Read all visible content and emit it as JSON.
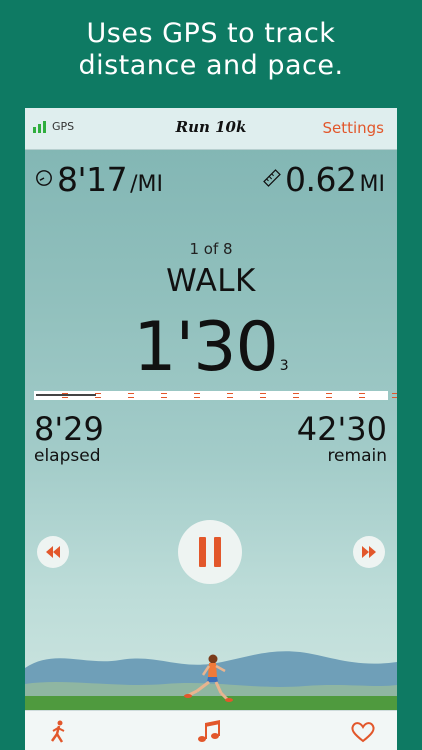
{
  "headline": {
    "line1": "Uses GPS to track",
    "line2": "distance and pace."
  },
  "navbar": {
    "gps_label": "GPS",
    "title": "Run 10k",
    "settings_label": "Settings"
  },
  "stats": {
    "pace_value": "8'17",
    "pace_unit": "/MI",
    "distance_value": "0.62",
    "distance_unit": "MI"
  },
  "interval": {
    "counter": "1 of 8",
    "phase": "WALK",
    "time_main": "1'30",
    "time_sub": "3",
    "progress_fraction": 0.17
  },
  "summary": {
    "elapsed_value": "8'29",
    "elapsed_label": "elapsed",
    "remain_value": "42'30",
    "remain_label": "remain"
  },
  "icons": {
    "pace": "speedometer-icon",
    "distance": "ruler-icon",
    "rewind": "rewind-icon",
    "pause": "pause-icon",
    "fast_forward": "fast-forward-icon",
    "runner_tab": "runner-icon",
    "music_tab": "music-note-icon",
    "heart_tab": "heart-icon"
  },
  "colors": {
    "background": "#0e7a63",
    "accent": "#e2572b",
    "gps_signal": "#2fae3e"
  }
}
